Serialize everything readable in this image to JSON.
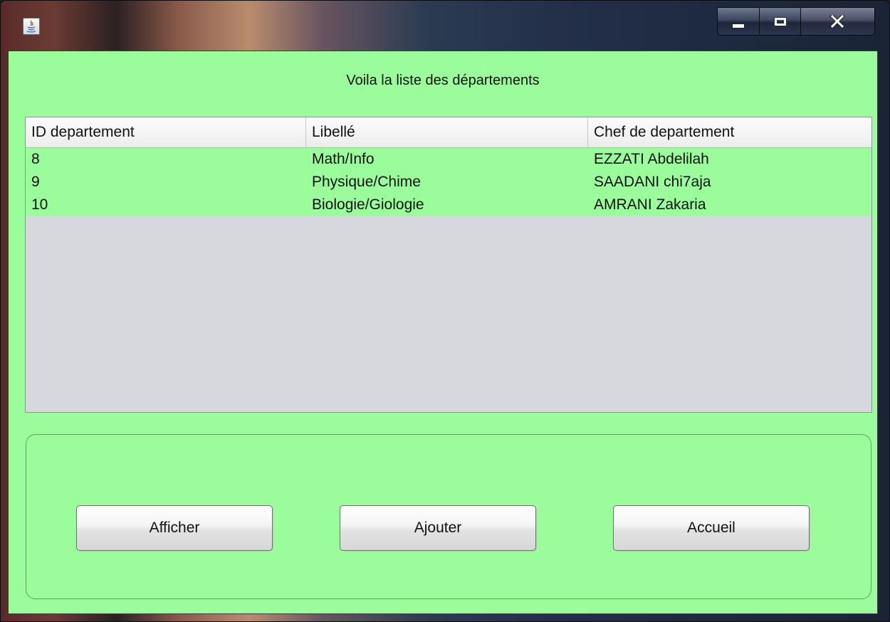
{
  "window": {
    "title": "",
    "icon": "java-icon",
    "controls": [
      "minimize-icon",
      "maximize-icon",
      "close-icon"
    ]
  },
  "heading": "Voila la liste des départements",
  "table": {
    "columns": [
      "ID departement",
      "Libellé",
      "Chef de departement"
    ],
    "rows": [
      [
        "8",
        "Math/Info",
        "EZZATI Abdelilah"
      ],
      [
        "9",
        "Physique/Chime",
        "SAADANI chi7aja"
      ],
      [
        "10",
        "Biologie/Giologie",
        "AMRANI Zakaria"
      ]
    ]
  },
  "buttons": {
    "afficher": "Afficher",
    "ajouter": "Ajouter",
    "accueil": "Accueil"
  },
  "colors": {
    "background": "#9bfc9b",
    "table_empty": "#d7d8de"
  }
}
